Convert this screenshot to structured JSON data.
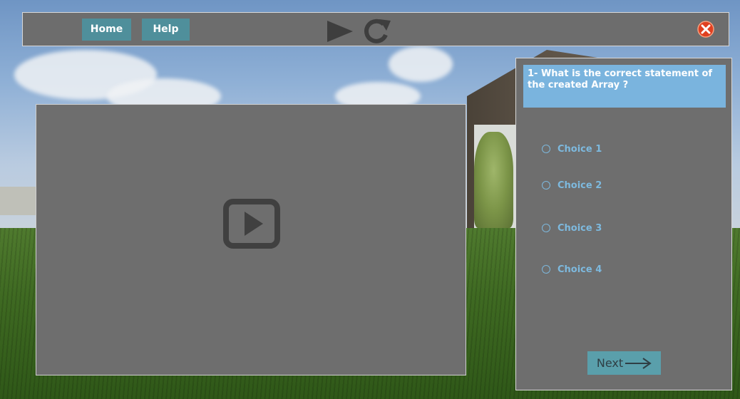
{
  "topbar": {
    "home_label": "Home",
    "help_label": "Help"
  },
  "quiz": {
    "question": "1- What is the correct statement of the created Array ?",
    "choices": [
      "Choice 1",
      "Choice 2",
      "Choice 3",
      "Choice 4"
    ],
    "next_label": "Next"
  },
  "icons": {
    "play": "play-icon",
    "replay": "replay-icon",
    "close": "close-icon",
    "video_play": "video-play-icon",
    "next_arrow": "arrow-right-icon"
  },
  "colors": {
    "button": "#4f8f9b",
    "question_bg": "#7ab4de",
    "choice_text": "#7db9de",
    "close_red": "#e04020"
  }
}
